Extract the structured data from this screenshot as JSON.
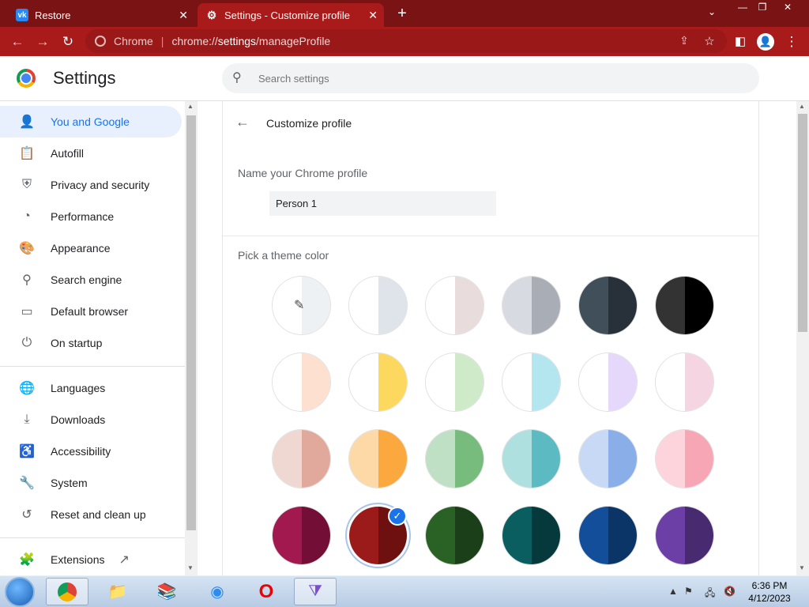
{
  "tabs": [
    {
      "title": "Restore",
      "favicon": "vk-icon"
    },
    {
      "title": "Settings - Customize profile",
      "favicon": "gear-icon",
      "active": true
    }
  ],
  "window_controls": {
    "minimize": "—",
    "restore": "❐",
    "close": "✕"
  },
  "omnibox": {
    "site": "Chrome",
    "url_prefix": "chrome://",
    "url_host": "settings",
    "url_path": "/manageProfile"
  },
  "header": {
    "title": "Settings",
    "search_placeholder": "Search settings"
  },
  "sidebar": {
    "items": [
      {
        "label": "You and Google",
        "icon": "person-icon",
        "glyph": "👤",
        "active": true
      },
      {
        "label": "Autofill",
        "icon": "clipboard-icon",
        "glyph": "📋"
      },
      {
        "label": "Privacy and security",
        "icon": "shield-icon",
        "glyph": "⛨"
      },
      {
        "label": "Performance",
        "icon": "speedometer-icon",
        "glyph": "◔"
      },
      {
        "label": "Appearance",
        "icon": "palette-icon",
        "glyph": "🎨"
      },
      {
        "label": "Search engine",
        "icon": "search-icon",
        "glyph": "⚲"
      },
      {
        "label": "Default browser",
        "icon": "browser-icon",
        "glyph": "▭"
      },
      {
        "label": "On startup",
        "icon": "power-icon",
        "glyph": "⏻"
      },
      {
        "label": "Languages",
        "icon": "globe-icon",
        "glyph": "🌐"
      },
      {
        "label": "Downloads",
        "icon": "download-icon",
        "glyph": "⤓"
      },
      {
        "label": "Accessibility",
        "icon": "accessibility-icon",
        "glyph": "♿"
      },
      {
        "label": "System",
        "icon": "wrench-icon",
        "glyph": "🔧"
      },
      {
        "label": "Reset and clean up",
        "icon": "history-icon",
        "glyph": "↺"
      },
      {
        "label": "Extensions",
        "icon": "puzzle-icon",
        "glyph": "🧩",
        "external": "↗"
      }
    ]
  },
  "customize": {
    "title": "Customize profile",
    "name_label": "Name your Chrome profile",
    "name_value": "Person 1",
    "theme_label": "Pick a theme color",
    "swatches": [
      [
        "#ffffff",
        "#eef1f3"
      ],
      [
        "#ffffff",
        "#dfe4ea"
      ],
      [
        "#ffffff",
        "#e8dcdc"
      ],
      [
        "#d7dae0",
        "#a9adb6"
      ],
      [
        "#414f5b",
        "#28313a"
      ],
      [
        "#333333",
        "#000000"
      ],
      [
        "#ffffff",
        "#fde0cf"
      ],
      [
        "#ffffff",
        "#fdd85e"
      ],
      [
        "#ffffff",
        "#cfeac8"
      ],
      [
        "#ffffff",
        "#b4e6f0"
      ],
      [
        "#ffffff",
        "#e6d8fb"
      ],
      [
        "#ffffff",
        "#f6d5e3"
      ],
      [
        "#f0d8d2",
        "#e0a99b"
      ],
      [
        "#fdd9a8",
        "#fba83e"
      ],
      [
        "#bfe0c4",
        "#78bc7d"
      ],
      [
        "#aee0e0",
        "#5bbac2"
      ],
      [
        "#c7d9f5",
        "#89aee8"
      ],
      [
        "#fdd3dc",
        "#f7a6b6"
      ],
      [
        "#a1194f",
        "#730f36"
      ],
      [
        "#9b1a1a",
        "#6e1010"
      ],
      [
        "#2a6125",
        "#1b3f18"
      ],
      [
        "#0b5e60",
        "#06393b"
      ],
      [
        "#124e9a",
        "#0b3566"
      ],
      [
        "#6c3fa6",
        "#482a70"
      ]
    ],
    "selected_index": 19
  },
  "taskbar": {
    "time": "6:36 PM",
    "date": "4/12/2023"
  }
}
